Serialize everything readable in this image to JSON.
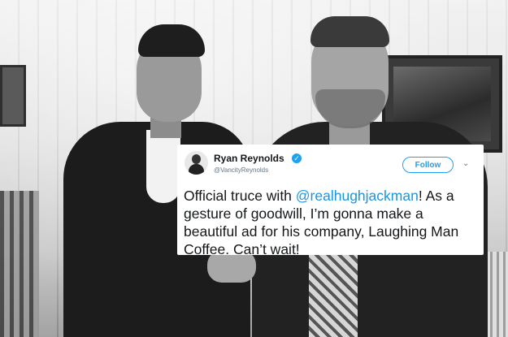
{
  "tweet": {
    "display_name": "Ryan Reynolds",
    "handle": "@VancityReynolds",
    "follow_label": "Follow",
    "text_before": "Official truce with ",
    "mention": "@realhughjackman",
    "text_after": "! As a gesture of goodwill, I’m gonna make a beautiful ad for his company, Laughing Man Coffee. Can’t wait!"
  },
  "icons": {
    "verified": "verified-badge-icon",
    "chevron": "chevron-down-icon"
  },
  "colors": {
    "accent": "#1da1f2",
    "mention": "#1b95e0",
    "text": "#14171a",
    "muted": "#657786"
  }
}
